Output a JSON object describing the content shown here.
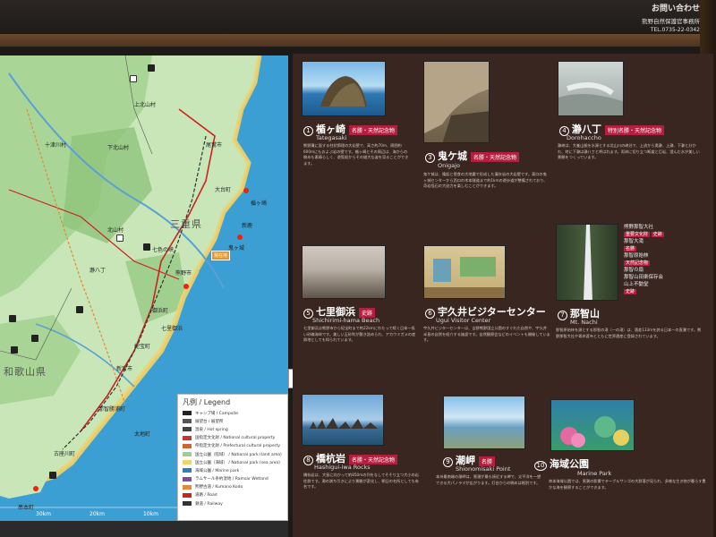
{
  "header": {
    "contact_title": "お問い合わせ",
    "contact_org": "熊野自然保護官事務所",
    "contact_tel": "TEL.0735-22-0342"
  },
  "map": {
    "prefecture": "三重県",
    "prefecture_west": "和歌山県",
    "places": [
      "上北山村",
      "下北山村",
      "十津川村",
      "尾鷲市",
      "大台町",
      "熊野市",
      "御浜町",
      "紀宝町",
      "新宮市",
      "那智勝浦町",
      "太地町",
      "串本町",
      "古座川町",
      "七色の峡",
      "瀞八丁",
      "北山村",
      "七里御浜",
      "鬼ヶ城",
      "楯ヶ崎",
      "新鹿"
    ],
    "highlight": "現在地",
    "scale_labels": [
      "30km",
      "20km",
      "10km",
      "0km"
    ]
  },
  "legend": {
    "title": "凡例 / Legend",
    "items": [
      {
        "label": "キャンプ場 / Campsite",
        "color": "#222222"
      },
      {
        "label": "展望台 / 展望所",
        "color": "#555555"
      },
      {
        "label": "温泉 / Hot spring",
        "color": "#444444"
      },
      {
        "label": "国指定文化財 / National cultural property",
        "color": "#cc3333"
      },
      {
        "label": "県指定文化財 / Prefectural cultural property",
        "color": "#cc6633"
      },
      {
        "label": "国立公園（陸域） / National park (land area)",
        "color": "#9fcf8f"
      },
      {
        "label": "国立公園（海域） / National park (sea area)",
        "color": "#f2d36b"
      },
      {
        "label": "海域公園 / Marine park",
        "color": "#2f7fb8"
      },
      {
        "label": "ラムサール条約湿地 / Ramsar Wetland",
        "color": "#7a4fa0"
      },
      {
        "label": "熊野古道 / Kumano Kodo",
        "color": "#e08a3a"
      },
      {
        "label": "道路 / Road",
        "color": "#cc2222"
      },
      {
        "label": "鉄道 / Railway",
        "color": "#333333"
      }
    ]
  },
  "spots": [
    {
      "num": "1",
      "jp": "楯ヶ崎",
      "en": "Tategasaki",
      "badges": [
        "名勝・天然記念物"
      ],
      "desc": "熊野灘に面する柱状節理の大岩壁で、高さ約70m、周囲約600mにもおよぶ岩の壁です。楯ヶ崎とその周辺は、海からの眺めも素晴らしく、遊覧船からその雄大な姿を見ることができます。"
    },
    {
      "num": "3",
      "jp": "鬼ケ城",
      "en": "Onigajo",
      "badges": [
        "名勝・天然記念物"
      ],
      "desc": "鬼ケ城は、隆起と侵食の大地震で形成した凝灰岩の大岩壁です。東口の鬼ヶ城センターから西口の木本隧道まで約1kmの遊歩道が整備されており、奇岩怪石の大迫力を楽しむことができます。"
    },
    {
      "num": "4",
      "jp": "瀞八丁",
      "en": "Dorohaccho",
      "badges": [
        "特別名勝・天然記念物"
      ],
      "desc": "瀞峡は、大峯山脈を水源とする北山川の峡谷で、上流から奥瀞、上瀞、下瀞と分かれ、特に下瀞は瀞八丁と呼ばれます。両岸に切り立つ断崖と巨岩、澄んだ水が美しい景観をつくっています。"
    },
    {
      "num": "5",
      "jp": "七里御浜",
      "en": "Shichirimi-hama Beach",
      "badges": [
        "史跡"
      ],
      "desc": "七里御浜は熊野市から紀宝町まで約22kmにわたって続く日本一長い砂礫海岸です。美しい玉砂利が敷き詰められ、アカウミガメの産卵地としても知られています。"
    },
    {
      "num": "6",
      "jp": "宇久井ビジターセンター",
      "en": "Ugui Visitor Center",
      "badges": [],
      "desc": "宇久井ビジターセンターは、吉野熊野国立公園のすぐれた自然や、宇久井半島の自然を紹介する施設です。自然観察会などのイベントも開催しています。"
    },
    {
      "num": "7",
      "jp": "那智山",
      "en": "Mt. Nachi",
      "badges": [],
      "desc": "那智原始林を源とする那智の滝（一の滝）は、落差133mを誇る日本一の直瀑です。熊野那智大社や青岸渡寺とともに世界遺産に登録されています。"
    },
    {
      "num": "8",
      "jp": "橋杭岩",
      "en": "Hashigui-iwa Rocks",
      "badges": [
        "名勝・天然記念物"
      ],
      "desc": "橋杭岩は、大島に向かって約850mの列をなしてそそり立つ大小の岩柱群です。潮の満ち引きにより景観が変化し、朝日の名所としても有名です。"
    },
    {
      "num": "9",
      "jp": "潮岬",
      "en": "Shionomisaki Point",
      "badges": [
        "名勝"
      ],
      "desc": "本州最南端の潮岬は、黒潮が最も接近する岬で、太平洋を一望できる大パノラマが広がります。灯台からの眺めは格別です。"
    },
    {
      "num": "10",
      "jp": "海域公園",
      "en": "Marine Park",
      "badges": [],
      "desc": "串本海域公園では、黒潮の影響でテーブルサンゴの大群落が見られ、多様な生き物が暮らす豊かな海を観察することができます。"
    }
  ],
  "nachi_side": {
    "items": [
      "熊野那智大社",
      "重要文化財",
      "史跡",
      "那智大滝",
      "名勝",
      "那智原始林",
      "天然記念物",
      "那智の扇",
      "那智山田楽保存会",
      "山上不動堂",
      "史跡"
    ]
  }
}
